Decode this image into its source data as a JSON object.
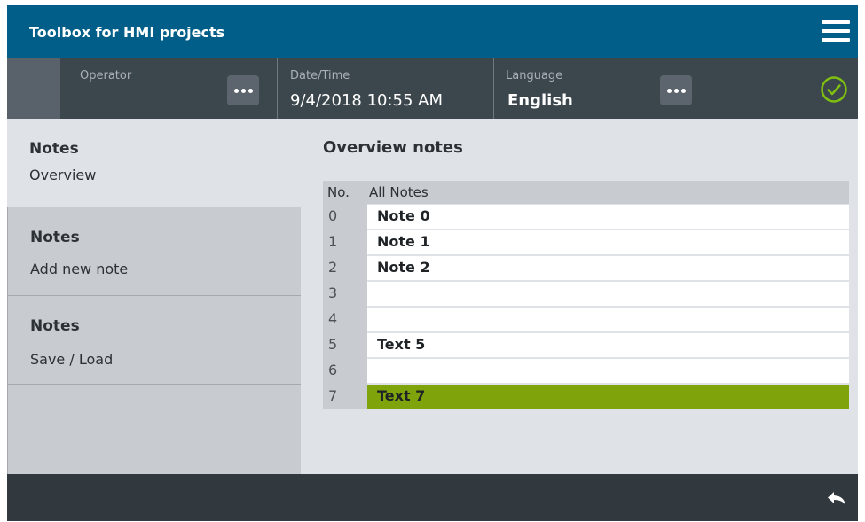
{
  "header": {
    "title": "Toolbox for HMI projects",
    "menu_icon": "hamburger-menu-icon"
  },
  "status": {
    "operator_label": "Operator",
    "datetime_label": "Date/Time",
    "datetime_value": "9/4/2018 10:55 AM",
    "language_label": "Language",
    "language_value": "English",
    "more_icon": "ellipsis-icon",
    "status_icon": "check-circle-icon",
    "status_color": "#7fbf10"
  },
  "nav": {
    "items": [
      {
        "title": "Notes",
        "subtitle": "Overview"
      },
      {
        "title": "Notes",
        "subtitle": "Add new note"
      },
      {
        "title": "Notes",
        "subtitle": "Save / Load"
      }
    ]
  },
  "main": {
    "title": "Overview notes",
    "table": {
      "headers": [
        "No.",
        "All Notes"
      ],
      "rows": [
        {
          "no": "0",
          "note": "Note 0"
        },
        {
          "no": "1",
          "note": "Note 1"
        },
        {
          "no": "2",
          "note": "Note 2"
        },
        {
          "no": "3",
          "note": ""
        },
        {
          "no": "4",
          "note": ""
        },
        {
          "no": "5",
          "note": "Text 5"
        },
        {
          "no": "6",
          "note": ""
        },
        {
          "no": "7",
          "note": "Text 7"
        }
      ],
      "selected_row": 7,
      "selected_color": "#7fa30b"
    }
  },
  "footer": {
    "back_icon": "back-arrow-icon"
  },
  "colors": {
    "title_bar": "#005e88",
    "status_bar": "#3c464d",
    "background": "#dfe2e6"
  }
}
